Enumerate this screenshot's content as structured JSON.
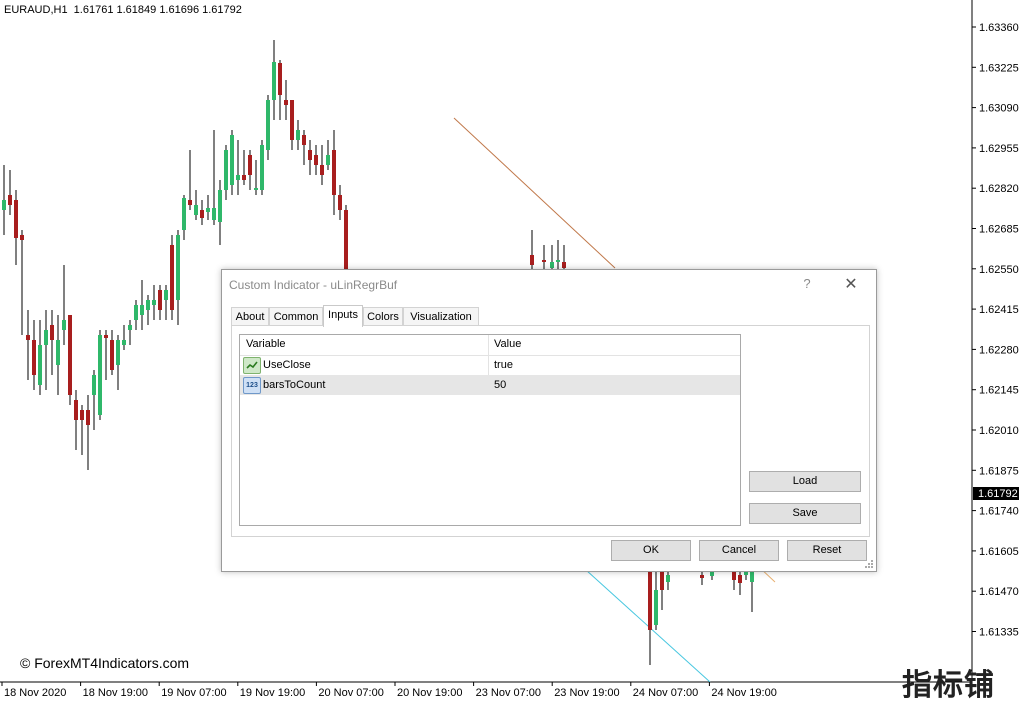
{
  "chart": {
    "symbol_header": "EURAUD,H1  1.61761 1.61849 1.61696 1.61792",
    "current_price": "1.61792",
    "price_labels": [
      "1.63360",
      "1.63225",
      "1.63090",
      "1.62955",
      "1.62820",
      "1.62685",
      "1.62550",
      "1.62415",
      "1.62280",
      "1.62145",
      "1.62010",
      "1.61875",
      "1.61740",
      "1.61605",
      "1.61470",
      "1.61335"
    ],
    "time_labels": [
      "18 Nov 2020",
      "18 Nov 19:00",
      "19 Nov 07:00",
      "19 Nov 19:00",
      "20 Nov 07:00",
      "20 Nov 19:00",
      "23 Nov 07:00",
      "23 Nov 19:00",
      "24 Nov 07:00",
      "24 Nov 19:00"
    ],
    "watermark": "© ForexMT4Indicators.com",
    "corner_logo": "指标铺",
    "colors": {
      "bull": "#2fb86a",
      "bear": "#a81e1e",
      "regression_upper": "#c0784a",
      "regression_lower": "#48c7e0",
      "current_price_box": "#000000"
    }
  },
  "dialog": {
    "title": "Custom Indicator - uLinRegrBuf",
    "help_label": "?",
    "close_label": "✕",
    "tabs": [
      {
        "label": "About"
      },
      {
        "label": "Common"
      },
      {
        "label": "Inputs"
      },
      {
        "label": "Colors"
      },
      {
        "label": "Visualization"
      }
    ],
    "active_tab": "Inputs",
    "grid": {
      "headers": {
        "variable": "Variable",
        "value": "Value"
      },
      "rows": [
        {
          "variable": "UseClose",
          "value": "true",
          "icon": "boolean-icon"
        },
        {
          "variable": "barsToCount",
          "value": "50",
          "icon": "integer-icon",
          "icon_text": "123"
        }
      ]
    },
    "buttons": {
      "load": "Load",
      "save": "Save",
      "ok": "OK",
      "cancel": "Cancel",
      "reset": "Reset"
    }
  }
}
